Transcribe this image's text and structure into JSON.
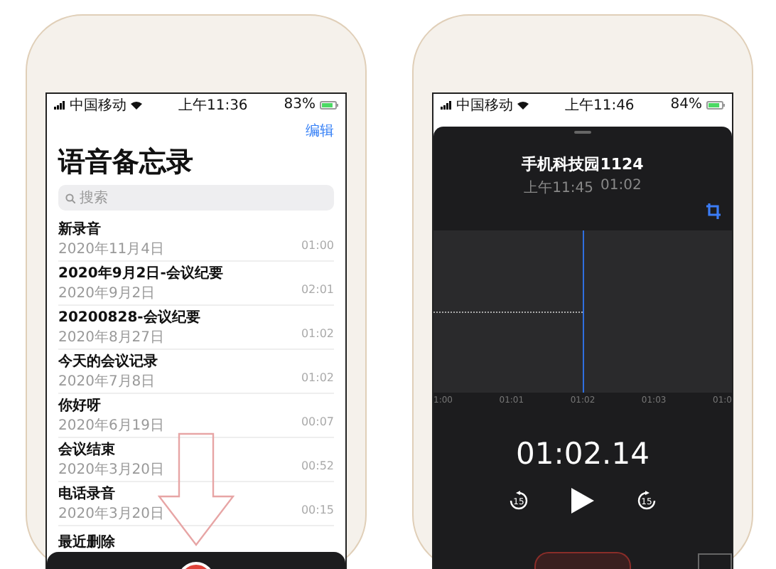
{
  "phones": [
    {
      "kind": "list",
      "status_bar": {
        "carrier": "中国移动",
        "time": "上午11:36",
        "battery": "83%",
        "battery_icon": {
          "level": 0.83
        }
      },
      "edit_link": "编辑",
      "title": "语音备忘录",
      "search": {
        "placeholder": "搜索"
      },
      "recordings": [
        {
          "title": "新录音",
          "date": "2020年11月4日",
          "duration": "01:00"
        },
        {
          "title": "2020年9月2日-会议纪要",
          "date": "2020年9月2日",
          "duration": "02:01"
        },
        {
          "title": "20200828-会议纪要",
          "date": "2020年8月27日",
          "duration": "01:02"
        },
        {
          "title": "今天的会议记录",
          "date": "2020年7月8日",
          "duration": "01:02"
        },
        {
          "title": "你好呀",
          "date": "2020年6月19日",
          "duration": "00:07"
        },
        {
          "title": "会议结束",
          "date": "2020年3月20日",
          "duration": "00:52"
        },
        {
          "title": "电话录音",
          "date": "2020年3月20日",
          "duration": "00:15"
        }
      ],
      "folder": "最近删除"
    },
    {
      "kind": "player",
      "status_bar": {
        "carrier": "中国移动",
        "time": "上午11:46",
        "battery": "84%",
        "battery_icon": {
          "level": 0.84
        }
      },
      "title": "手机科技园1124",
      "recorded_at": "上午11:45",
      "length": "01:02",
      "timeline": [
        "1:00",
        "01:01",
        "01:02",
        "01:03",
        "01:0"
      ],
      "playhead": {
        "level": 0.5
      },
      "elapsed": "01:02.14",
      "skip_back": "15",
      "skip_forward": "15"
    }
  ]
}
